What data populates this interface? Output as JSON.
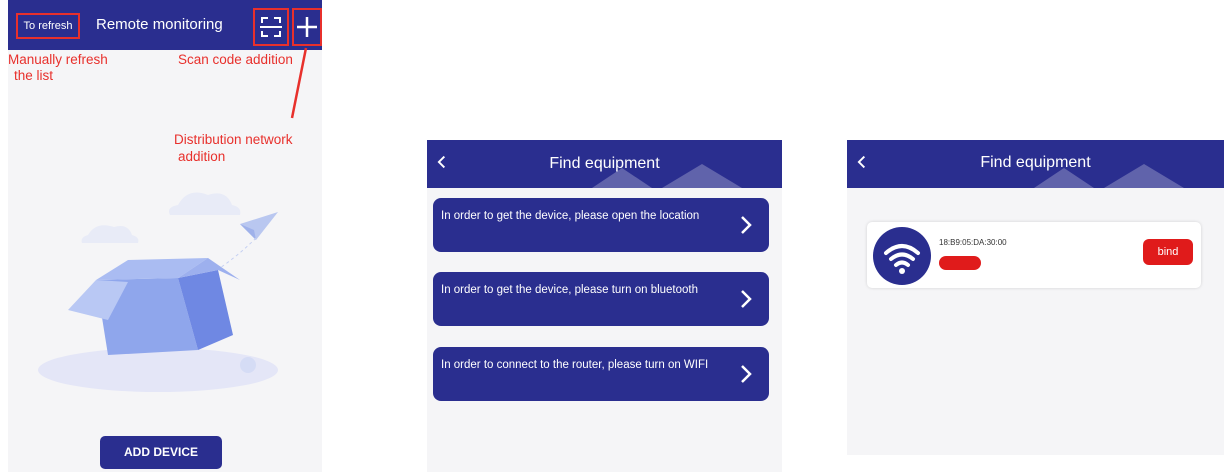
{
  "screen1": {
    "refresh_label": "To refresh",
    "title": "Remote monitoring",
    "add_device_label": "ADD DEVICE",
    "annotations": {
      "refresh_line1": "Manually refresh",
      "refresh_line2": "the list",
      "scan": "Scan code addition",
      "network_line1": "Distribution network",
      "network_line2": "addition"
    },
    "icons": [
      "scan-icon",
      "plus-icon",
      "empty-box-illustration"
    ]
  },
  "screen2": {
    "title": "Find equipment",
    "items": [
      {
        "text": "In order to get the device, please open the location"
      },
      {
        "text": "In order to get the device, please turn on bluetooth"
      },
      {
        "text": "In order to connect to the router, please turn on WIFI"
      }
    ]
  },
  "screen3": {
    "title": "Find equipment",
    "device": {
      "mac": "18:B9:05:DA:30:00",
      "bind_label": "bind"
    }
  },
  "colors": {
    "primary": "#2a2e8f",
    "annotation": "#e8302c",
    "bind": "#e01b1b",
    "screen_bg": "#f5f5f7"
  }
}
